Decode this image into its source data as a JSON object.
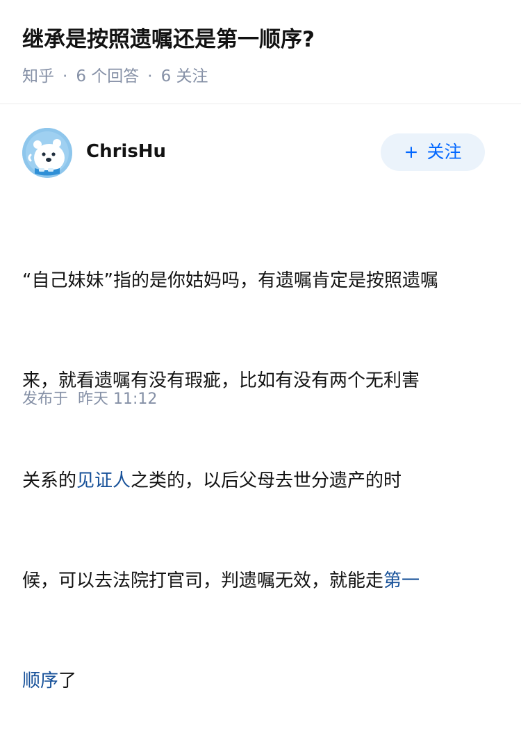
{
  "question": {
    "title": "继承是按照遗嘱还是第一顺序?",
    "source": "知乎",
    "answers_count": "6 个回答",
    "followers_count": "6 关注"
  },
  "author": {
    "name": "ChrisHu",
    "follow_label": "关注",
    "follow_prefix": "+"
  },
  "answer": {
    "line1": "“自己妹妹”指的是你姑妈吗，有遗嘱肯定是按照遗嘱",
    "line2": "来，就看遗嘱有没有瑕疵，比如有没有两个无利害",
    "line3_a": "关系的",
    "line3_link": "见证人",
    "line3_b": "之类的，以后父母去世分遗产的时",
    "line4_a": "候，可以去法院打官司，判遗嘱无效，就能走",
    "line4_link": "第一",
    "line5_link": "顺序",
    "line5_b": "了"
  },
  "footer": {
    "publish_label": "发布于",
    "publish_time": "昨天 11:12"
  },
  "colors": {
    "link": "#175199",
    "meta": "#8590a6",
    "follow_bg": "#ebf3fb",
    "follow_text": "#0066ff"
  },
  "icons": {
    "avatar": "avatar-polar-bear-icon",
    "meta_separator": "dot"
  }
}
